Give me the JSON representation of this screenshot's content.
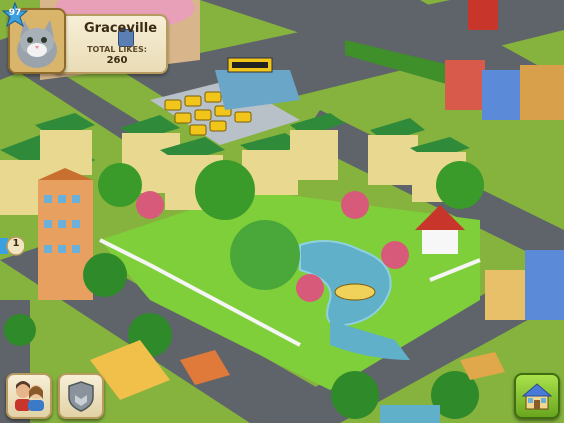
{
  "hud": {
    "level": "97",
    "city_name": "Graceville",
    "total_likes_label": "TOTAL LIKES:",
    "total_likes_value": "260",
    "quest_count": "1"
  },
  "buttons": {
    "friends": "friends-icon",
    "shield": "shield-icon",
    "build": "build-house-icon"
  },
  "colors": {
    "grass": "#7fbf3a",
    "road": "#5f6468",
    "water": "#5fb0c8",
    "hud_card": "#f1e6c4",
    "build_button": "#7ec12e"
  }
}
